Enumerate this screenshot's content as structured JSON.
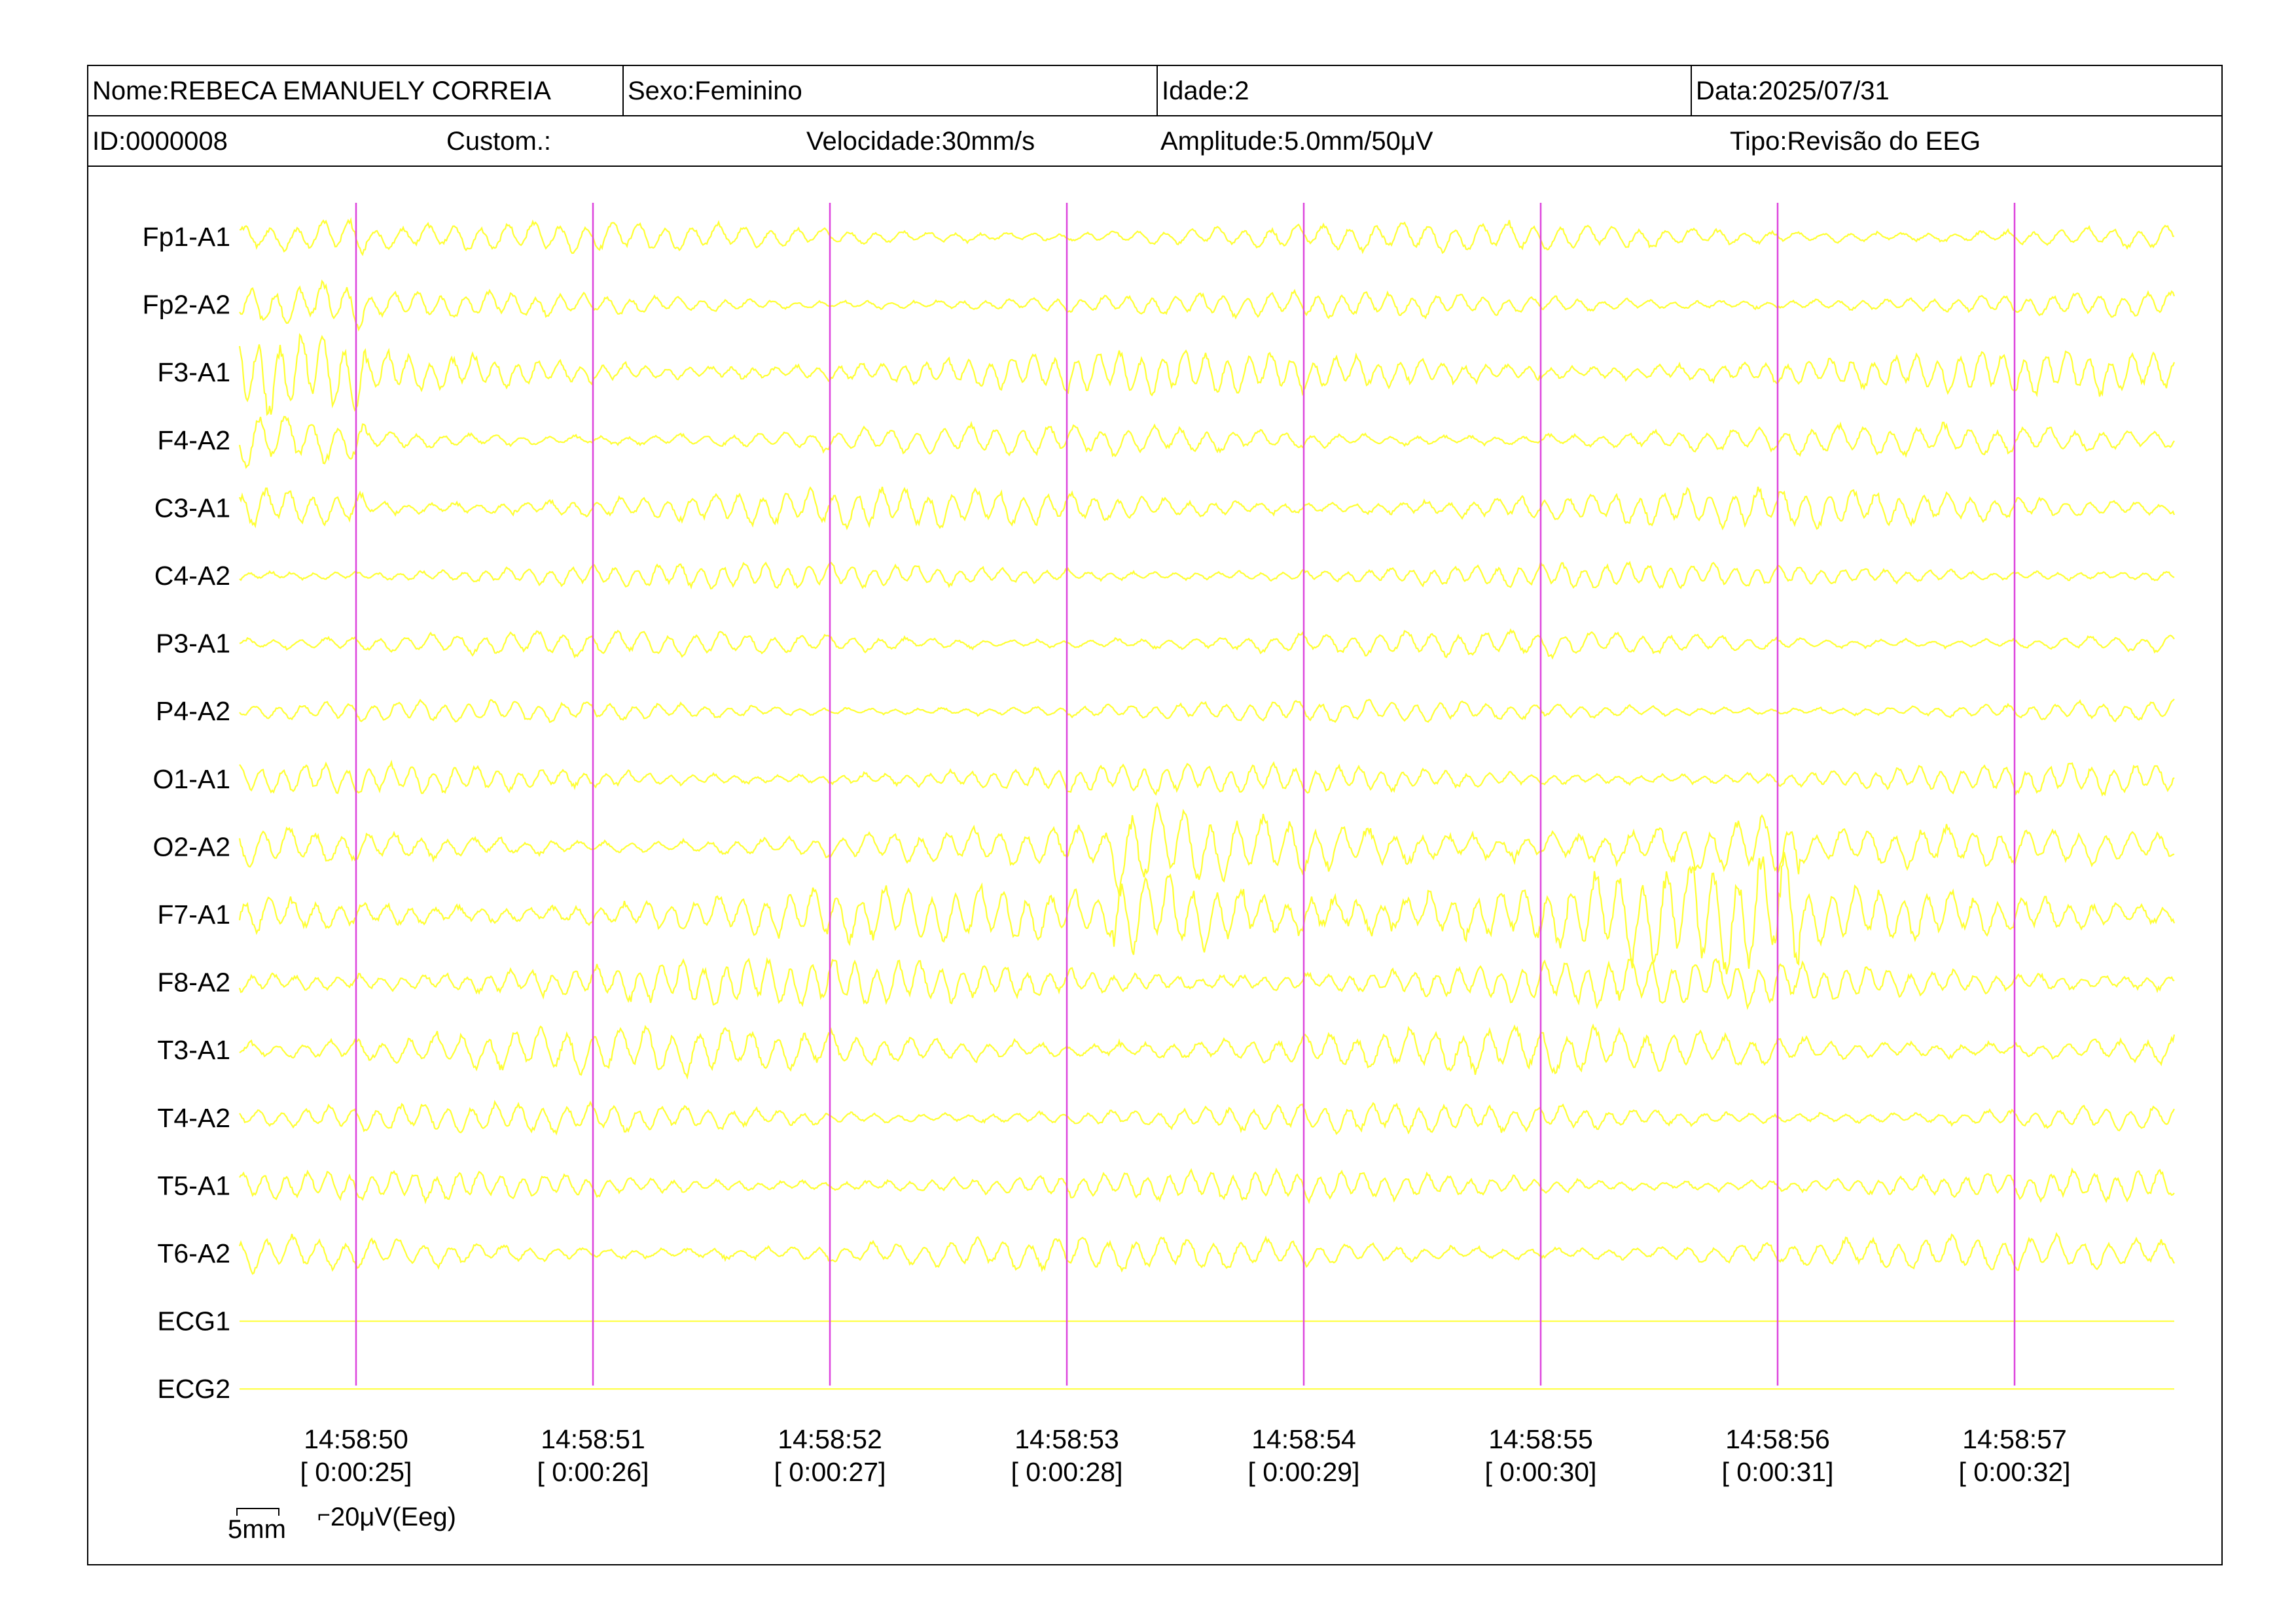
{
  "header": {
    "nome": "Nome:REBECA EMANUELY CORREIA",
    "sexo": "Sexo:Feminino",
    "idade": "Idade:2",
    "data": "Data:2025/07/31",
    "id": "ID:0000008",
    "custom": "Custom.:",
    "velocidade": "Velocidade:30mm/s",
    "amplitude": "Amplitude:5.0mm/50μV",
    "tipo": "Tipo:Revisão do EEG"
  },
  "scale": {
    "time": "5mm",
    "amplitude": "20μV(Eeg)"
  },
  "colors": {
    "trace": "#ffff33",
    "marker": "#dd44dd",
    "frame": "#000000"
  },
  "chart_data": {
    "type": "line",
    "channels": [
      "Fp1-A1",
      "Fp2-A2",
      "F3-A1",
      "F4-A2",
      "C3-A1",
      "C4-A2",
      "P3-A1",
      "P4-A2",
      "O1-A1",
      "O2-A2",
      "F7-A1",
      "F8-A2",
      "T3-A1",
      "T4-A2",
      "T5-A1",
      "T6-A2",
      "ECG1",
      "ECG2"
    ],
    "time_markers": [
      {
        "clock": "14:58:50",
        "elapsed": "[ 0:00:25]"
      },
      {
        "clock": "14:58:51",
        "elapsed": "[ 0:00:26]"
      },
      {
        "clock": "14:58:52",
        "elapsed": "[ 0:00:27]"
      },
      {
        "clock": "14:58:53",
        "elapsed": "[ 0:00:28]"
      },
      {
        "clock": "14:58:54",
        "elapsed": "[ 0:00:29]"
      },
      {
        "clock": "14:58:55",
        "elapsed": "[ 0:00:30]"
      },
      {
        "clock": "14:58:56",
        "elapsed": "[ 0:00:31]"
      },
      {
        "clock": "14:58:57",
        "elapsed": "[ 0:00:32]"
      }
    ],
    "time_range_s": [
      24.5,
      32.65
    ],
    "grid": false,
    "legend": "none"
  }
}
